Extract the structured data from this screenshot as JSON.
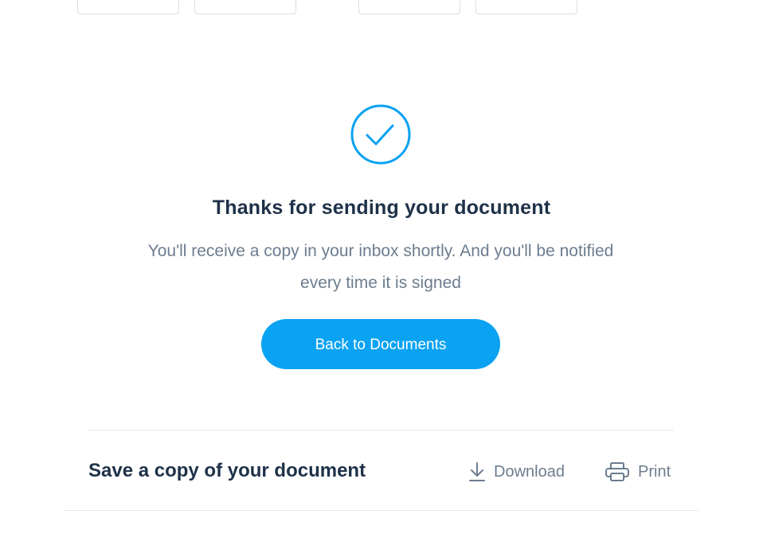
{
  "colors": {
    "accent": "#0aa2f2",
    "heading": "#1e3148",
    "body_text": "#6c7d8f",
    "divider": "#e3e7ec"
  },
  "success": {
    "icon": "checkmark-circle-icon",
    "title": "Thanks for sending your document",
    "message": "You'll receive a copy in your inbox shortly. And you'll be notified every time it is signed",
    "primary_button": "Back to Documents"
  },
  "save_copy": {
    "title": "Save a copy of your document",
    "download": {
      "label": "Download",
      "icon": "download-icon"
    },
    "print": {
      "label": "Print",
      "icon": "printer-icon"
    }
  }
}
